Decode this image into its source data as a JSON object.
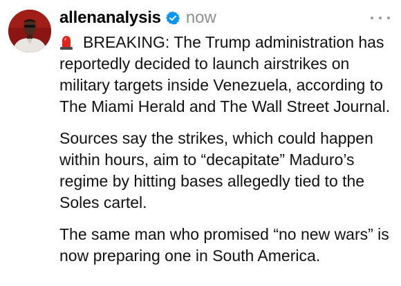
{
  "post": {
    "username": "allenanalysis",
    "timestamp": "now",
    "icons": {
      "avatar": "profile-photo",
      "verified": "verified-badge-icon",
      "more": "more-options-icon",
      "siren": "police-siren-emoji"
    },
    "paragraphs": [
      "BREAKING: The Trump administration has reportedly decided to launch airstrikes on military targets inside Venezuela, according to The Miami Herald and The Wall Street Journal.",
      "Sources say the strikes, which could happen within hours, aim to “decapitate” Maduro’s regime by hitting bases allegedly tied to the Soles cartel.",
      "The same man who promised “no new wars” is now preparing one in South America."
    ]
  },
  "colors": {
    "verified": "#0095f6",
    "username": "#000000",
    "timestamp": "#8e8e8e",
    "text": "#111111",
    "siren": "#e0241b"
  }
}
